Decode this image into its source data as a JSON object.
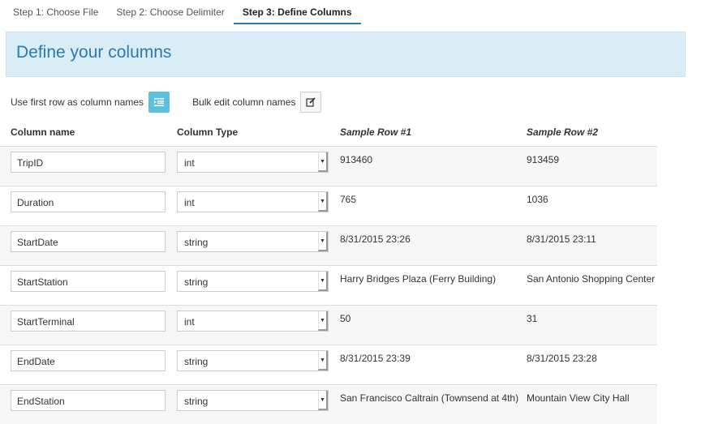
{
  "tabs": [
    {
      "label": "Step 1: Choose File"
    },
    {
      "label": "Step 2: Choose Delimiter"
    },
    {
      "label": "Step 3: Define Columns",
      "active": true
    }
  ],
  "banner": {
    "title": "Define your columns"
  },
  "options": {
    "first_row_label": "Use first row as column names",
    "first_row_icon": "list-indent-icon",
    "bulk_edit_label": "Bulk edit column names",
    "bulk_edit_icon": "edit-icon"
  },
  "colors": {
    "accent": "#2a7ab0",
    "banner_bg": "#d9edf7",
    "button_blue": "#5bc0de"
  },
  "table": {
    "headers": {
      "name": "Column name",
      "type": "Column Type",
      "sample1": "Sample Row #1",
      "sample2": "Sample Row #2"
    },
    "rows": [
      {
        "name": "TripID",
        "type": "int",
        "sample1": "913460",
        "sample2": "913459"
      },
      {
        "name": "Duration",
        "type": "int",
        "sample1": "765",
        "sample2": "1036"
      },
      {
        "name": "StartDate",
        "type": "string",
        "sample1": "8/31/2015 23:26",
        "sample2": "8/31/2015 23:11"
      },
      {
        "name": "StartStation",
        "type": "string",
        "sample1": "Harry Bridges Plaza (Ferry Building)",
        "sample2": "San Antonio Shopping Center"
      },
      {
        "name": "StartTerminal",
        "type": "int",
        "sample1": "50",
        "sample2": "31"
      },
      {
        "name": "EndDate",
        "type": "string",
        "sample1": "8/31/2015 23:39",
        "sample2": "8/31/2015 23:28"
      },
      {
        "name": "EndStation",
        "type": "string",
        "sample1": "San Francisco Caltrain (Townsend at 4th)",
        "sample2": "Mountain View City Hall"
      }
    ]
  }
}
